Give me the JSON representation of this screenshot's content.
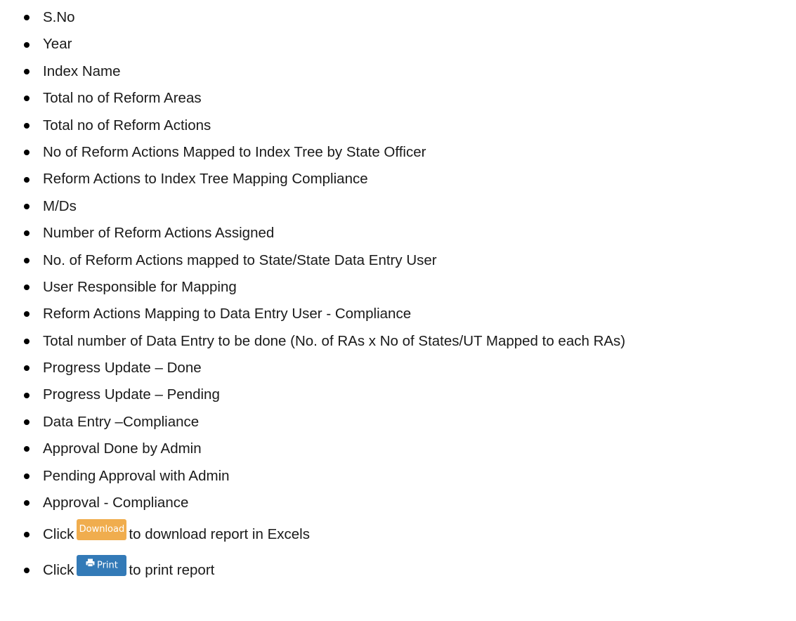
{
  "list_items": [
    "S.No",
    "Year",
    "Index Name",
    "Total no of Reform Areas",
    "Total no of Reform Actions",
    "No of Reform Actions Mapped to Index Tree by State Officer",
    "Reform Actions to Index Tree Mapping Compliance",
    "M/Ds",
    "Number of Reform Actions Assigned",
    "No. of Reform Actions mapped to State/State Data Entry User",
    "User Responsible for Mapping",
    "Reform Actions Mapping to Data Entry User - Compliance",
    "Total number of Data Entry to be done (No. of RAs x No of States/UT Mapped to each RAs)",
    "Progress Update – Done",
    "Progress Update – Pending",
    "Data Entry –Compliance",
    "Approval Done by Admin",
    "Pending Approval with Admin",
    "Approval - Compliance"
  ],
  "download_item": {
    "prefix": "Click",
    "button_label": "Download",
    "suffix": "to download report in Excels"
  },
  "print_item": {
    "prefix": "Click",
    "button_label": "Print",
    "button_icon": "printer-icon",
    "suffix": "to print report"
  },
  "colors": {
    "download_button": "#f0ad4e",
    "print_button": "#337ab7",
    "button_text": "#ffffff"
  }
}
